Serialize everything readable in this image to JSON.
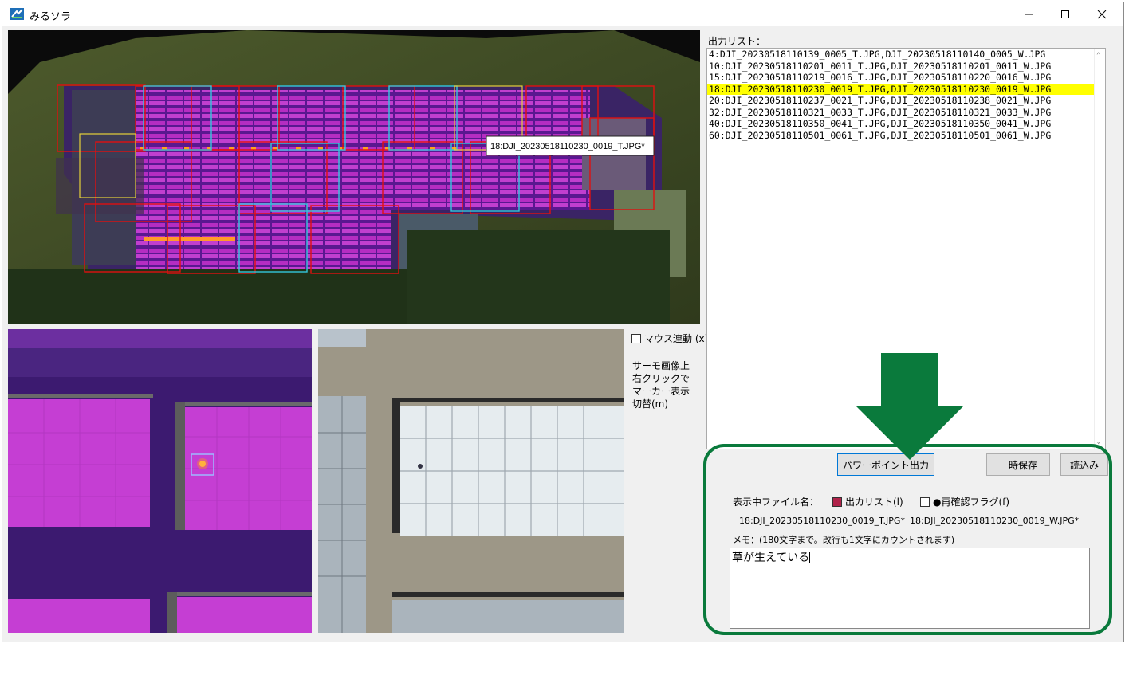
{
  "app": {
    "title": "みるソラ",
    "controls": {
      "minimize": "─",
      "maximize": "☐",
      "close": "✕"
    }
  },
  "map": {
    "tooltip": "18:DJI_20230518110230_0019_T.JPG*"
  },
  "mouse_link": {
    "label": "マウス連動 (x)"
  },
  "side_note": {
    "lines": [
      "サーモ画像上",
      "右クリックで",
      "マーカー表示",
      "切替(m)"
    ]
  },
  "output_list": {
    "label": "出力リスト：",
    "rows": [
      "4:DJI_20230518110139_0005_T.JPG,DJI_20230518110140_0005_W.JPG",
      "10:DJI_20230518110201_0011_T.JPG,DJI_20230518110201_0011_W.JPG",
      "15:DJI_20230518110219_0016_T.JPG,DJI_20230518110220_0016_W.JPG",
      "18:DJI_20230518110230_0019_T.JPG,DJI_20230518110230_0019_W.JPG",
      "20:DJI_20230518110237_0021_T.JPG,DJI_20230518110238_0021_W.JPG",
      "32:DJI_20230518110321_0033_T.JPG,DJI_20230518110321_0033_W.JPG",
      "40:DJI_20230518110350_0041_T.JPG,DJI_20230518110350_0041_W.JPG",
      "60:DJI_20230518110501_0061_T.JPG,DJI_20230518110501_0061_W.JPG"
    ],
    "selected_index": 3,
    "selected_color": "#ffff00"
  },
  "buttons": {
    "powerpoint": "パワーポイント出力",
    "temp_save": "一時保存",
    "load": "読込み"
  },
  "file_info": {
    "display_label": "表示中ファイル名：",
    "output_list_check": "出カリスト(l)",
    "recheck_flag": "●再確認フラグ(f)",
    "thermal_file": "18:DJI_20230518110230_0019_T.JPG*",
    "visible_file": "18:DJI_20230518110230_0019_W.JPG*"
  },
  "memo": {
    "label": "メモ：(180文字まで。改行も1文字にカウントされます)",
    "value": "草が生えている"
  },
  "colors": {
    "highlight_green": "#0a7a3c",
    "output_check": "#b0234a",
    "thermal_purple": "#c43bd2"
  }
}
